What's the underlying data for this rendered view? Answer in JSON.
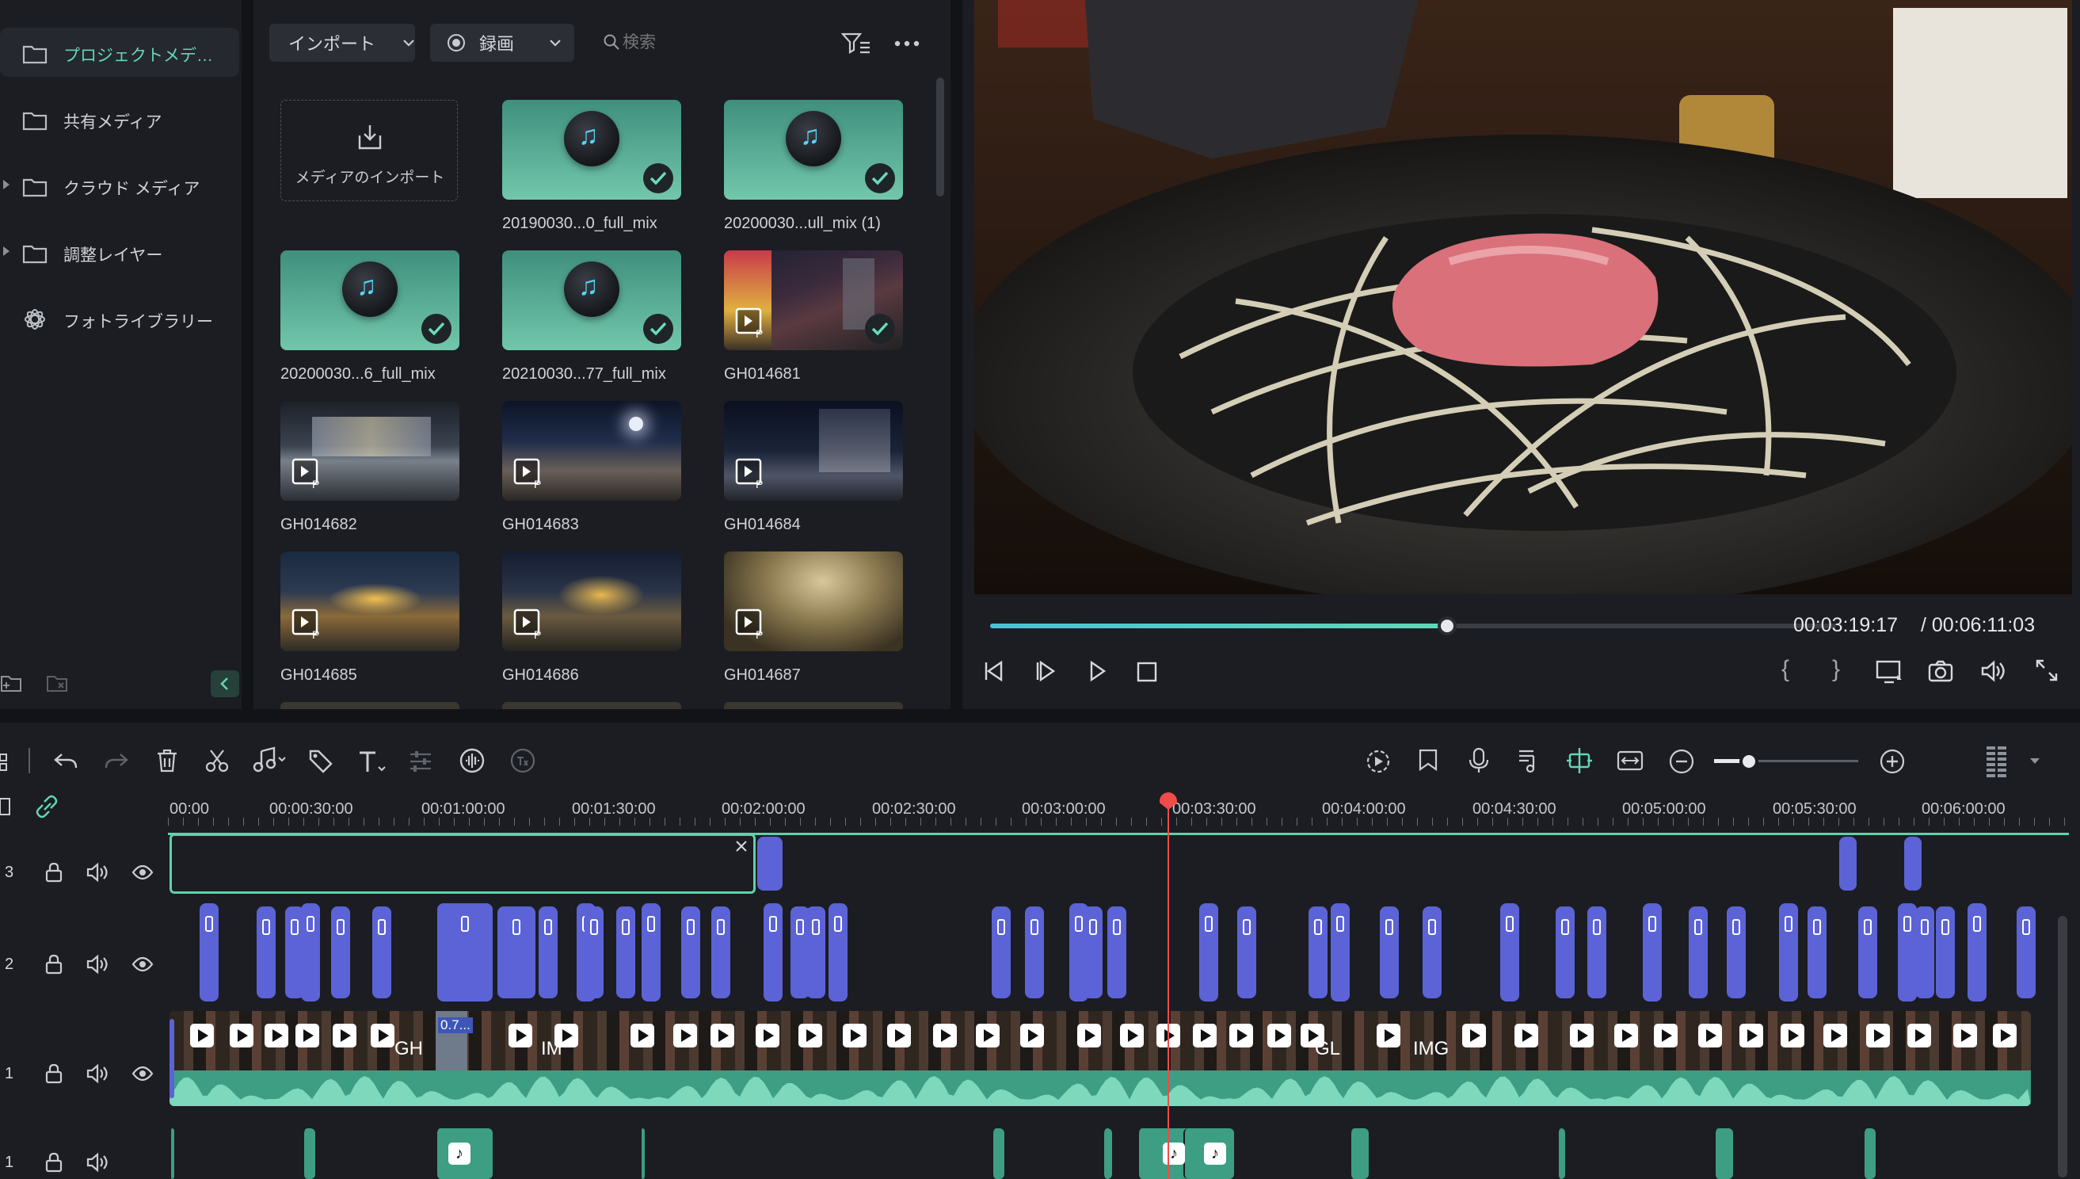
{
  "sidebar": {
    "items": [
      {
        "label": "プロジェクトメデ…",
        "icon": "folder-icon",
        "active": true
      },
      {
        "label": "共有メディア",
        "icon": "folder-icon"
      },
      {
        "label": "クラウド メディア",
        "icon": "folder-icon"
      },
      {
        "label": "調整レイヤー",
        "icon": "folder-icon"
      },
      {
        "label": "フォトライブラリー",
        "icon": "photos-icon"
      }
    ]
  },
  "media_toolbar": {
    "import_label": "インポート",
    "record_label": "録画",
    "search_placeholder": "検索"
  },
  "media": {
    "import_tile_label": "メディアのインポート",
    "items": [
      {
        "name": "20190030...0_full_mix",
        "kind": "audio",
        "checked": true
      },
      {
        "name": "20200030...ull_mix (1)",
        "kind": "audio",
        "checked": true
      },
      {
        "name": "20200030...6_full_mix",
        "kind": "audio",
        "checked": true
      },
      {
        "name": "20210030...77_full_mix",
        "kind": "audio",
        "checked": true
      },
      {
        "name": "GH014681",
        "kind": "video",
        "checked": true
      },
      {
        "name": "GH014682",
        "kind": "video",
        "checked": false
      },
      {
        "name": "GH014683",
        "kind": "video",
        "checked": false
      },
      {
        "name": "GH014684",
        "kind": "video",
        "checked": false
      },
      {
        "name": "GH014685",
        "kind": "video",
        "checked": false
      },
      {
        "name": "GH014686",
        "kind": "video",
        "checked": false
      },
      {
        "name": "GH014687",
        "kind": "video",
        "checked": false
      }
    ]
  },
  "player": {
    "current_time": "00:03:19:17",
    "total_time": "/ 00:06:11:03",
    "progress": 0.54
  },
  "timeline": {
    "ruler": [
      "00:00",
      "00:00:30:00",
      "00:01:00:00",
      "00:01:30:00",
      "00:02:00:00",
      "00:02:30:00",
      "00:03:00:00",
      "00:03:30:00",
      "00:04:00:00",
      "00:04:30:00",
      "00:05:00:00",
      "00:05:30:00",
      "00:06:00:00"
    ],
    "tracks": [
      {
        "number": "3"
      },
      {
        "number": "2"
      },
      {
        "number": "1"
      },
      {
        "number": "1"
      }
    ],
    "clip_labels": {
      "video_gh": "GH",
      "video_img": "IM",
      "video_gl": "GL",
      "video_img2": "IMG",
      "speed": "0.7..."
    }
  },
  "colors": {
    "accent": "#63d6b6",
    "clip_blue": "#5c63d6",
    "playhead": "#ef4b4b"
  }
}
